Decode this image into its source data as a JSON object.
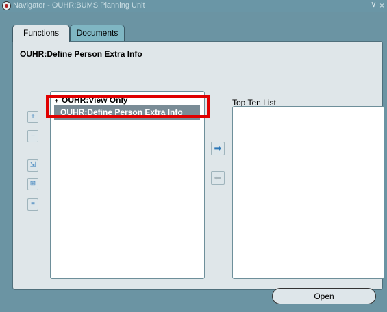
{
  "window": {
    "title": "Navigator - OUHR:BUMS Planning Unit",
    "minimize_glyph": "⊻",
    "close_glyph": "×"
  },
  "tabs": [
    {
      "label": "Functions",
      "active": true
    },
    {
      "label": "Documents",
      "active": false
    }
  ],
  "panel": {
    "title": "OUHR:Define Person Extra Info"
  },
  "side_buttons": [
    {
      "icon": "expand-icon",
      "glyph": "+"
    },
    {
      "icon": "collapse-icon",
      "glyph": "−"
    },
    {
      "icon": "expand-branch-icon",
      "glyph": "⇲"
    },
    {
      "icon": "expand-all-icon",
      "glyph": "⊞"
    },
    {
      "icon": "collapse-all-icon",
      "glyph": "≡"
    }
  ],
  "function_list": {
    "items": [
      {
        "label": "OUHR:View Only",
        "expand_glyph": "+",
        "selected": false
      },
      {
        "label": "OUHR:Define Person Extra Info",
        "selected": true
      }
    ]
  },
  "arrows": {
    "add_glyph": "➡",
    "remove_glyph": "⬅"
  },
  "top_ten": {
    "label": "Top Ten List",
    "items": []
  },
  "open_button": {
    "label": "Open"
  },
  "colors": {
    "background": "#6b94a3",
    "selection": "#7a8c96",
    "highlight": "#e00000"
  }
}
